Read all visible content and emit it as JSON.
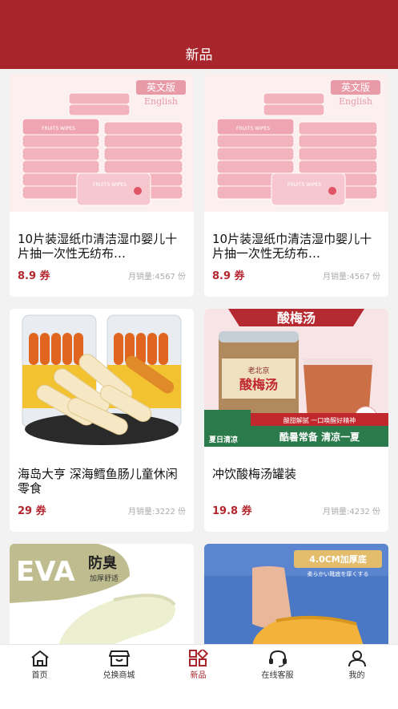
{
  "header": {
    "title": "新品"
  },
  "products": [
    {
      "name": "10片装湿纸巾清洁湿巾婴儿十片抽一次性无纺布…",
      "price": "8.9 券",
      "sales": "月销量:4567 份",
      "badge_cn": "英文版",
      "badge_en": "English",
      "pack_text": "FRUITS WIPES"
    },
    {
      "name": "10片装湿纸巾清洁湿巾婴儿十片抽一次性无纺布…",
      "price": "8.9 券",
      "sales": "月销量:4567 份",
      "badge_cn": "英文版",
      "badge_en": "English",
      "pack_text": "FRUITS WIPES"
    },
    {
      "name": "海岛大亨 深海鳕鱼肠儿童休闲零食",
      "price": "29 券",
      "sales": "月销量:3222 份"
    },
    {
      "name": "冲饮酸梅汤罐装",
      "price": "19.8 券",
      "sales": "月销量:4232 份",
      "img_title": "酸梅汤",
      "jar_label": "酸梅汤",
      "brand": "老北京",
      "gift": "赠送",
      "promo_left": "夏日清凉",
      "promo_tag": "酸甜解腻 一口唤醒好精神",
      "promo_line": "酷暑常备 清凉一夏"
    },
    {
      "img_title": "EVA",
      "img_title2": "防臭",
      "img_sub": "加厚舒适"
    },
    {
      "img_title": "4.0CM加厚底",
      "img_sub": "柔らかい靴底を厚くする"
    }
  ],
  "tabbar": [
    {
      "label": "首页",
      "icon": "home-icon"
    },
    {
      "label": "兑换商城",
      "icon": "shop-icon"
    },
    {
      "label": "新品",
      "icon": "grid-icon",
      "active": true
    },
    {
      "label": "在线客服",
      "icon": "headset-icon"
    },
    {
      "label": "我的",
      "icon": "user-icon"
    }
  ],
  "colors": {
    "brand": "#a8262b",
    "price": "#b3262d"
  }
}
